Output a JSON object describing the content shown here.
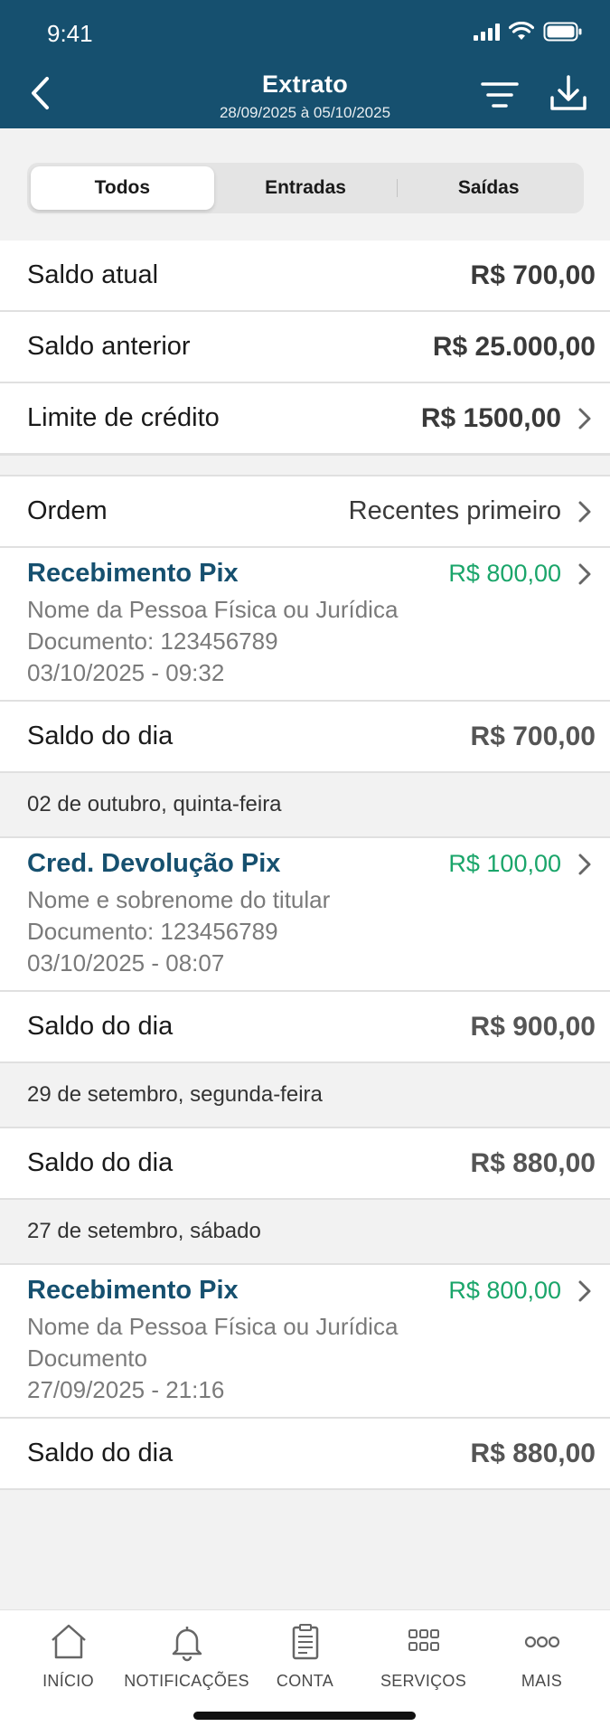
{
  "status_bar": {
    "time": "9:41"
  },
  "header": {
    "title": "Extrato",
    "subtitle": "28/09/2025 à 05/10/2025"
  },
  "segments": [
    "Todos",
    "Entradas",
    "Saídas"
  ],
  "summary": [
    {
      "label": "Saldo atual",
      "value": "R$ 700,00"
    },
    {
      "label": "Saldo anterior",
      "value": "R$ 25.000,00"
    },
    {
      "label": "Limite de crédito",
      "value": "R$ 1500,00"
    }
  ],
  "order": {
    "label": "Ordem",
    "value": "Recentes primeiro"
  },
  "groups": [
    {
      "transactions": [
        {
          "title": "Recebimento Pix",
          "amount": "R$ 800,00",
          "name": "Nome da Pessoa Física ou Jurídica",
          "document": "Documento: 123456789",
          "datetime": "03/10/2025 - 09:32"
        }
      ],
      "day_balance_label": "Saldo do dia",
      "day_balance": "R$ 700,00"
    },
    {
      "date": "02 de outubro, quinta-feira",
      "transactions": [
        {
          "title": "Cred. Devolução Pix",
          "amount": "R$ 100,00",
          "name": "Nome e sobrenome do titular",
          "document": "Documento: 123456789",
          "datetime": "03/10/2025 - 08:07"
        }
      ],
      "day_balance_label": "Saldo do dia",
      "day_balance": "R$ 900,00"
    },
    {
      "date": "29 de setembro, segunda-feira",
      "day_balance_label": "Saldo do dia",
      "day_balance": "R$ 880,00"
    },
    {
      "date": "27 de setembro, sábado",
      "transactions": [
        {
          "title": "Recebimento Pix",
          "amount": "R$ 800,00",
          "name": "Nome da Pessoa Física ou Jurídica",
          "document": "Documento",
          "datetime": "27/09/2025 - 21:16"
        }
      ],
      "day_balance_label": "Saldo do dia",
      "day_balance": "R$ 880,00"
    }
  ],
  "bottom_nav": [
    {
      "label": "INÍCIO",
      "icon": "home-icon"
    },
    {
      "label": "NOTIFICAÇÕES",
      "icon": "bell-icon"
    },
    {
      "label": "CONTA",
      "icon": "clipboard-icon"
    },
    {
      "label": "SERVIÇOS",
      "icon": "grid-icon"
    },
    {
      "label": "MAIS",
      "icon": "more-icon"
    }
  ],
  "colors": {
    "header_bg": "#16506f",
    "title_blue": "#16506f",
    "amount_green": "#1aa56a"
  }
}
